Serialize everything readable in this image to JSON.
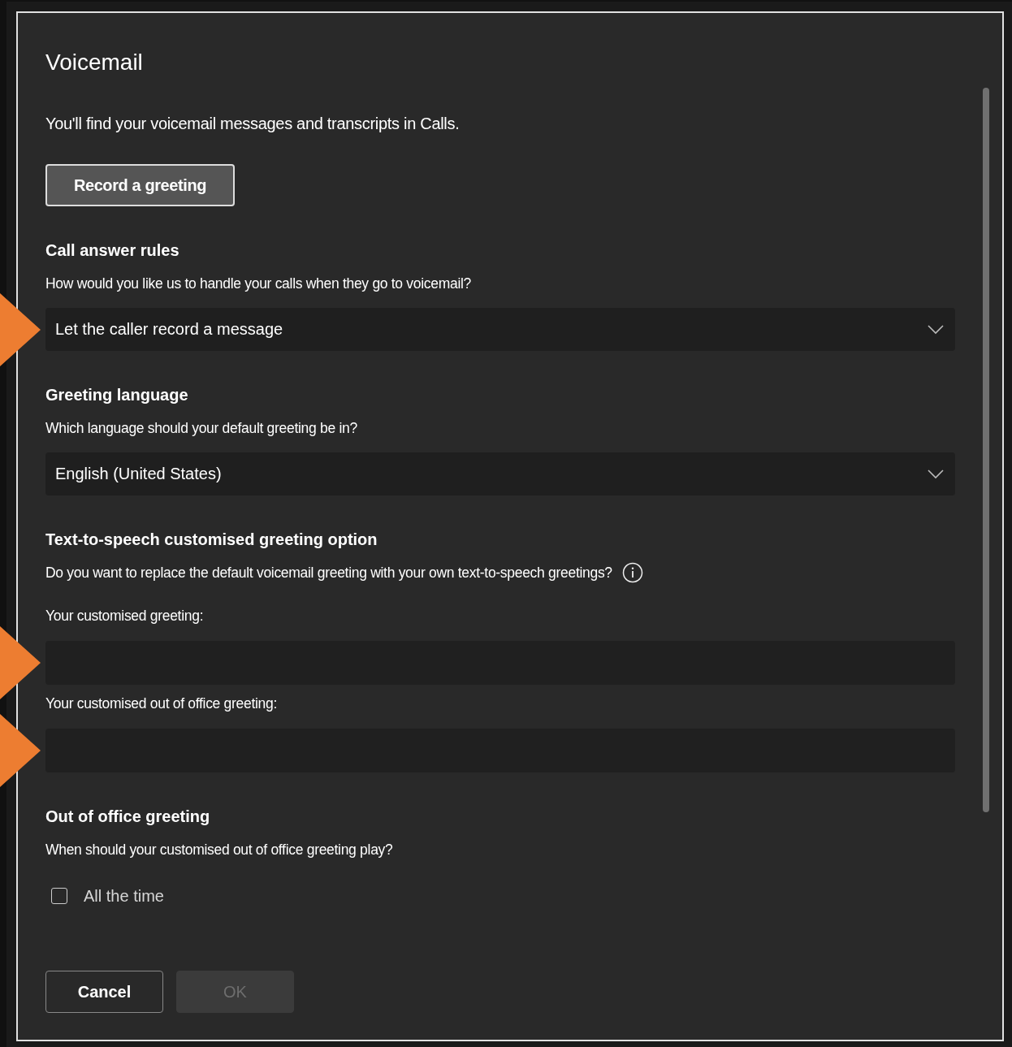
{
  "dialog": {
    "title": "Voicemail",
    "intro": "You'll find your voicemail messages and transcripts in Calls.",
    "record_button": "Record a greeting",
    "sections": [
      {
        "heading": "Call answer rules",
        "description": "How would you like us to handle your calls when they go to voicemail?",
        "info": false,
        "controls": [
          {
            "kind": "dropdown",
            "value": "Let the caller record a message",
            "marked": true
          }
        ]
      },
      {
        "heading": "Greeting language",
        "description": "Which language should your default greeting be in?",
        "info": false,
        "controls": [
          {
            "kind": "dropdown",
            "value": "English (United States)",
            "marked": false
          }
        ]
      },
      {
        "heading": "Text-to-speech customised greeting option",
        "description": "Do you want to replace the default voicemail greeting with your own text-to-speech greetings?",
        "info": true,
        "controls": [
          {
            "kind": "label",
            "text": "Your customised greeting:"
          },
          {
            "kind": "textbox",
            "marked": true
          },
          {
            "kind": "label",
            "text": "Your customised out of office greeting:"
          },
          {
            "kind": "textbox",
            "marked": true
          }
        ]
      },
      {
        "heading": "Out of office greeting",
        "description": "When should your customised out of office greeting play?",
        "info": false,
        "controls": [
          {
            "kind": "checkbox",
            "label": "All the time",
            "checked": false
          }
        ]
      }
    ],
    "buttons": [
      {
        "label": "Cancel",
        "disabled": false
      },
      {
        "label": "OK",
        "disabled": true
      }
    ]
  }
}
